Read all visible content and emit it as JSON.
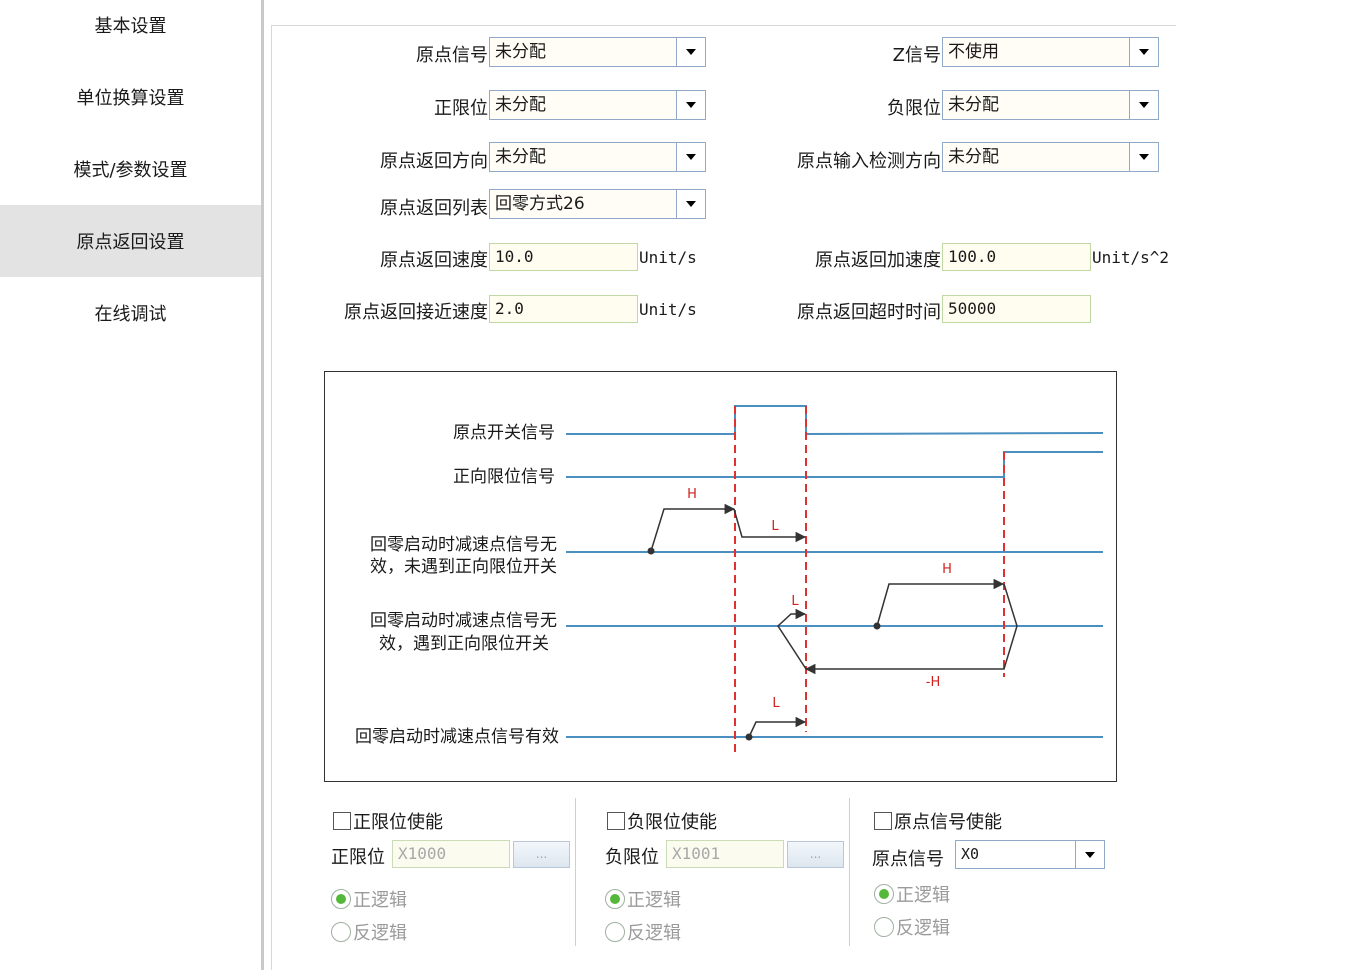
{
  "sidebar": {
    "items": [
      {
        "label": "基本设置",
        "active": false
      },
      {
        "label": "单位换算设置",
        "active": false
      },
      {
        "label": "模式/参数设置",
        "active": false
      },
      {
        "label": "原点返回设置",
        "active": true
      },
      {
        "label": "在线调试",
        "active": false
      }
    ]
  },
  "settings": {
    "origin_signal": {
      "label": "原点信号",
      "value": "未分配"
    },
    "z_signal": {
      "label": "Z信号",
      "value": "不使用"
    },
    "pos_limit": {
      "label": "正限位",
      "value": "未分配"
    },
    "neg_limit": {
      "label": "负限位",
      "value": "未分配"
    },
    "return_direction": {
      "label": "原点返回方向",
      "value": "未分配"
    },
    "input_detect_direction": {
      "label": "原点输入检测方向",
      "value": "未分配"
    },
    "return_list": {
      "label": "原点返回列表",
      "value": "回零方式26"
    },
    "return_speed": {
      "label": "原点返回速度",
      "value": "10.0",
      "unit": "Unit/s"
    },
    "return_accel": {
      "label": "原点返回加速度",
      "value": "100.0",
      "unit": "Unit/s^2"
    },
    "approach_speed": {
      "label": "原点返回接近速度",
      "value": "2.0",
      "unit": "Unit/s"
    },
    "timeout": {
      "label": "原点返回超时时间",
      "value": "50000"
    }
  },
  "diagram": {
    "rows": {
      "origin_switch": "原点开关信号",
      "pos_limit_signal": "正向限位信号",
      "case1_line1": "回零启动时减速点信号无",
      "case1_line2": "效，未遇到正向限位开关",
      "case2_line1": "回零启动时减速点信号无",
      "case2_line2": "效，遇到正向限位开关",
      "case3": "回零启动时减速点信号有效"
    },
    "marks": {
      "h": "H",
      "l": "L",
      "neg_h": "-H"
    },
    "colors": {
      "signal": "#4a8fc0",
      "edge": "#e03030",
      "path": "#333333"
    }
  },
  "limits": {
    "pos": {
      "enable_label": "正限位使能",
      "field_label": "正限位",
      "value": "X1000",
      "browse": "...",
      "positive_logic": "正逻辑",
      "negative_logic": "反逻辑"
    },
    "neg": {
      "enable_label": "负限位使能",
      "field_label": "负限位",
      "value": "X1001",
      "browse": "...",
      "positive_logic": "正逻辑",
      "negative_logic": "反逻辑"
    },
    "origin": {
      "enable_label": "原点信号使能",
      "field_label": "原点信号",
      "value": "X0",
      "positive_logic": "正逻辑",
      "negative_logic": "反逻辑"
    }
  },
  "colors": {
    "accent_radio": "#55b83a",
    "active_nav": "#e3e3e3",
    "combo_border": "#8fa9c7"
  }
}
